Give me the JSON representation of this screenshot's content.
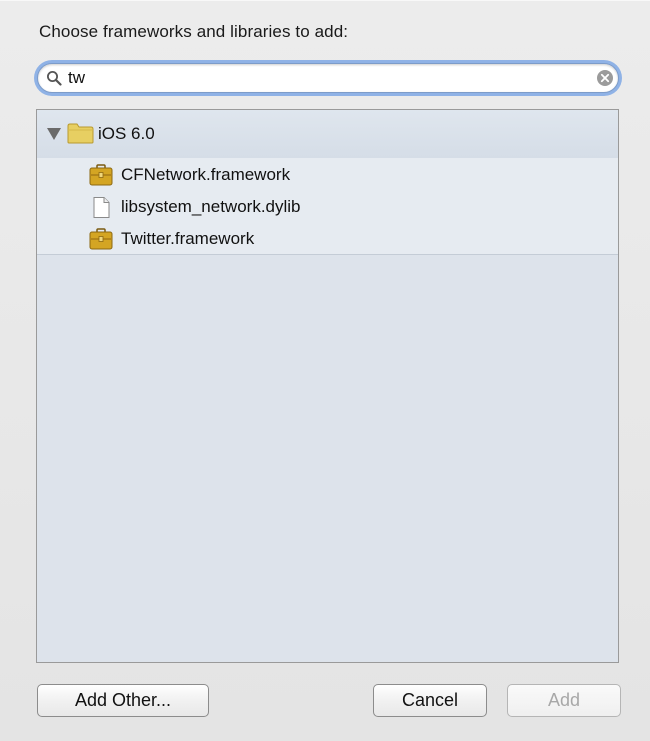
{
  "dialog": {
    "prompt": "Choose frameworks and libraries to add:"
  },
  "search": {
    "value": "tw",
    "placeholder": ""
  },
  "tree": {
    "group": {
      "label": "iOS 6.0",
      "icon": "folder-icon",
      "expanded": true
    },
    "items": [
      {
        "label": "CFNetwork.framework",
        "icon": "framework-icon"
      },
      {
        "label": "libsystem_network.dylib",
        "icon": "document-icon"
      },
      {
        "label": "Twitter.framework",
        "icon": "framework-icon"
      }
    ]
  },
  "buttons": {
    "add_other": "Add Other...",
    "cancel": "Cancel",
    "add": "Add"
  },
  "colors": {
    "focus_ring": "#8fb2e6",
    "list_background": "#dde3eb",
    "folder": "#e6c84f",
    "framework": "#d1a21e"
  }
}
